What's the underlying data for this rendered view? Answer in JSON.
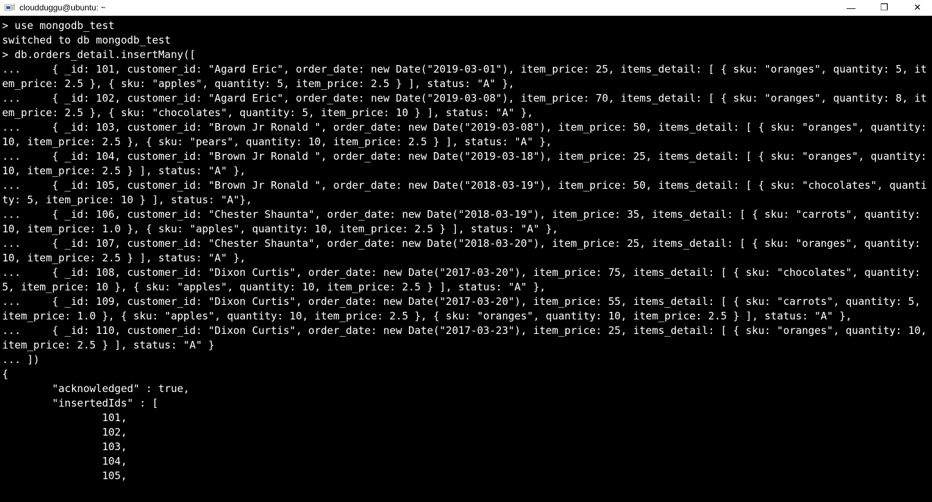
{
  "window": {
    "title": "cloudduggu@ubuntu: ~",
    "icon_name": "putty-icon",
    "controls": {
      "minimize": "—",
      "maximize": "❐",
      "close": "✕"
    }
  },
  "terminal": {
    "lines": [
      "> use mongodb_test",
      "switched to db mongodb_test",
      "> db.orders_detail.insertMany([",
      "...     { _id: 101, customer_id: \"Agard Eric\", order_date: new Date(\"2019-03-01\"), item_price: 25, items_detail: [ { sku: \"oranges\", quantity: 5, item_price: 2.5 }, { sku: \"apples\", quantity: 5, item_price: 2.5 } ], status: \"A\" },",
      "...     { _id: 102, customer_id: \"Agard Eric\", order_date: new Date(\"2019-03-08\"), item_price: 70, items_detail: [ { sku: \"oranges\", quantity: 8, item_price: 2.5 }, { sku: \"chocolates\", quantity: 5, item_price: 10 } ], status: \"A\" },",
      "...     { _id: 103, customer_id: \"Brown Jr Ronald \", order_date: new Date(\"2019-03-08\"), item_price: 50, items_detail: [ { sku: \"oranges\", quantity: 10, item_price: 2.5 }, { sku: \"pears\", quantity: 10, item_price: 2.5 } ], status: \"A\" },",
      "...     { _id: 104, customer_id: \"Brown Jr Ronald \", order_date: new Date(\"2019-03-18\"), item_price: 25, items_detail: [ { sku: \"oranges\", quantity: 10, item_price: 2.5 } ], status: \"A\" },",
      "...     { _id: 105, customer_id: \"Brown Jr Ronald \", order_date: new Date(\"2018-03-19\"), item_price: 50, items_detail: [ { sku: \"chocolates\", quantity: 5, item_price: 10 } ], status: \"A\"},",
      "...     { _id: 106, customer_id: \"Chester Shaunta\", order_date: new Date(\"2018-03-19\"), item_price: 35, items_detail: [ { sku: \"carrots\", quantity: 10, item_price: 1.0 }, { sku: \"apples\", quantity: 10, item_price: 2.5 } ], status: \"A\" },",
      "...     { _id: 107, customer_id: \"Chester Shaunta\", order_date: new Date(\"2018-03-20\"), item_price: 25, items_detail: [ { sku: \"oranges\", quantity: 10, item_price: 2.5 } ], status: \"A\" },",
      "...     { _id: 108, customer_id: \"Dixon Curtis\", order_date: new Date(\"2017-03-20\"), item_price: 75, items_detail: [ { sku: \"chocolates\", quantity: 5, item_price: 10 }, { sku: \"apples\", quantity: 10, item_price: 2.5 } ], status: \"A\" },",
      "...     { _id: 109, customer_id: \"Dixon Curtis\", order_date: new Date(\"2017-03-20\"), item_price: 55, items_detail: [ { sku: \"carrots\", quantity: 5, item_price: 1.0 }, { sku: \"apples\", quantity: 10, item_price: 2.5 }, { sku: \"oranges\", quantity: 10, item_price: 2.5 } ], status: \"A\" },",
      "...     { _id: 110, customer_id: \"Dixon Curtis\", order_date: new Date(\"2017-03-23\"), item_price: 25, items_detail: [ { sku: \"oranges\", quantity: 10, item_price: 2.5 } ], status: \"A\" }",
      "... ])",
      "{",
      "        \"acknowledged\" : true,",
      "        \"insertedIds\" : [",
      "                101,",
      "                102,",
      "                103,",
      "                104,",
      "                105,"
    ]
  }
}
